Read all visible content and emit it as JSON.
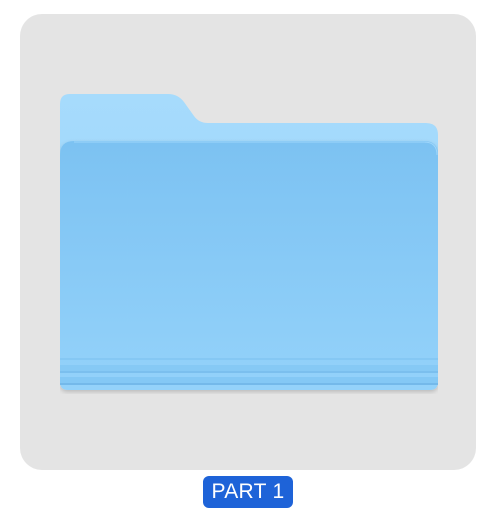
{
  "file": {
    "name": "PART 1",
    "icon": "folder-icon",
    "selected": true
  },
  "colors": {
    "selection_background": "#e4e4e4",
    "label_background": "#1e63d8",
    "label_text": "#ffffff",
    "folder_back": "#a2d8fb",
    "folder_front_top": "#7ec4f3",
    "folder_front_bottom": "#92d1f9"
  }
}
